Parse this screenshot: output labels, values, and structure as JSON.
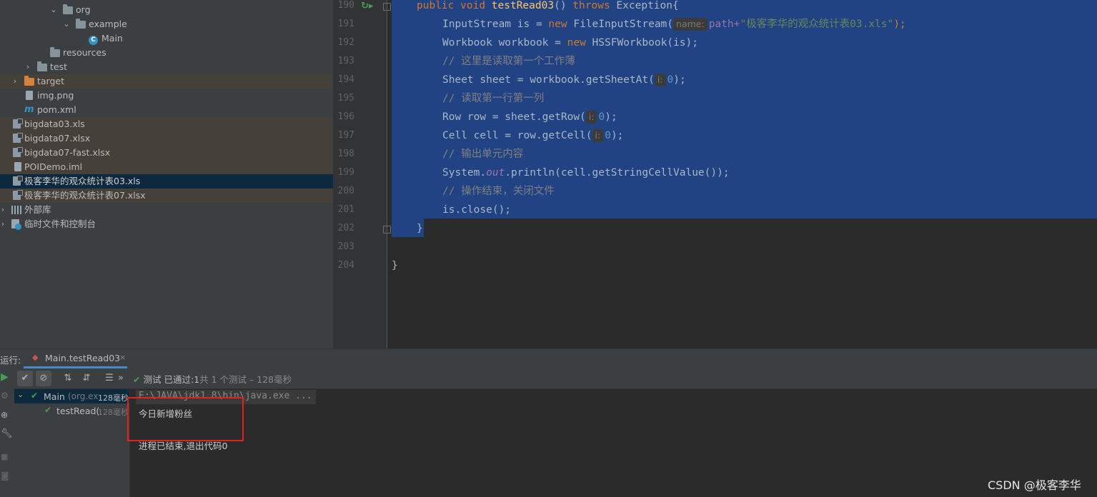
{
  "project_tree": [
    {
      "label": "org",
      "icon": "folder-icon",
      "chevron": "expanded"
    },
    {
      "label": "example",
      "icon": "package-icon",
      "chevron": "expanded"
    },
    {
      "label": "Main",
      "icon": "java-class-icon"
    },
    {
      "label": "resources",
      "icon": "resources-folder-icon"
    },
    {
      "label": "test",
      "icon": "folder-icon",
      "chevron": "collapsed"
    },
    {
      "label": "target",
      "icon": "excluded-folder-icon",
      "chevron": "collapsed"
    },
    {
      "label": "img.png",
      "icon": "image-file-icon"
    },
    {
      "label": "pom.xml",
      "icon": "maven-icon"
    },
    {
      "label": "bigdata03.xls",
      "icon": "xls-file-icon"
    },
    {
      "label": "bigdata07.xlsx",
      "icon": "xls-file-icon"
    },
    {
      "label": "bigdata07-fast.xlsx",
      "icon": "xls-file-icon"
    },
    {
      "label": "POIDemo.iml",
      "icon": "iml-file-icon"
    },
    {
      "label": "极客李华的观众统计表03.xls",
      "icon": "xls-file-icon"
    },
    {
      "label": "极客李华的观众统计表07.xlsx",
      "icon": "xls-file-icon"
    },
    {
      "label": "外部库",
      "icon": "library-icon",
      "chevron": "collapsed"
    },
    {
      "label": "临时文件和控制台",
      "icon": "scratches-icon",
      "chevron": "collapsed"
    }
  ],
  "editor": {
    "line_numbers": [
      "190",
      "191",
      "192",
      "193",
      "194",
      "195",
      "196",
      "197",
      "198",
      "199",
      "200",
      "201",
      "202",
      "203",
      "204"
    ],
    "tokens": {
      "l190_public": "public",
      "l190_void": "void",
      "l190_name": "testRead03",
      "l190_parens": "() ",
      "l190_throws": "throws",
      "l190_rest": " Exception{",
      "l191_a": "InputStream is = ",
      "l191_new": "new",
      "l191_b": " FileInputStream(",
      "l191_hint": "name:",
      "l191_c": "path+",
      "l191_str": "\"极客李华的观众统计表03.xls\"",
      "l191_d": ");",
      "l192_a": "Workbook workbook = ",
      "l192_new": "new",
      "l192_b": " HSSFWorkbook(is);",
      "l193_cm": "// 这里是读取第一个工作薄",
      "l194_a": "Sheet sheet = workbook.getSheetAt(",
      "l194_hint": "i:",
      "l194_num": "0",
      "l194_b": ");",
      "l195_cm": "// 读取第一行第一列",
      "l196_a": "Row row = sheet.getRow(",
      "l196_hint": "i:",
      "l196_num": "0",
      "l196_b": ");",
      "l197_a": "Cell cell = row.getCell(",
      "l197_hint": "i:",
      "l197_num": "0",
      "l197_b": ");",
      "l198_cm": "// 输出单元内容",
      "l199_a": "System.",
      "l199_out": "out",
      "l199_b": ".println(cell.getStringCellValue());",
      "l200_cm": "// 操作结束，关闭文件",
      "l201_a": "is.close();",
      "l202_a": "}",
      "l204_a": "}"
    }
  },
  "run_window": {
    "label": "运行:",
    "tab_label": "Main.testRead03",
    "status_prefix": "测试",
    "status_passed": "已通过:",
    "status_count": "1",
    "status_rest": "共 1 个测试 – 128毫秒",
    "tree": [
      {
        "name": "Main",
        "detail": "(org.ex",
        "time": "128毫秒"
      },
      {
        "name": "testRead(",
        "detail": "",
        "time": "128毫秒"
      }
    ],
    "console_lines": [
      "E:\\JAVA\\jdk1.8\\bin\\java.exe ...",
      "今日新增粉丝",
      "进程已结束,退出代码0"
    ]
  },
  "watermark": "CSDN @极客李华",
  "colors": {
    "selection": "#214283",
    "keyword": "#cc7832",
    "string": "#6a8759",
    "number": "#6897bb",
    "comment": "#808080",
    "annotation_box": "#e0241b",
    "pass_green": "#499c54"
  }
}
